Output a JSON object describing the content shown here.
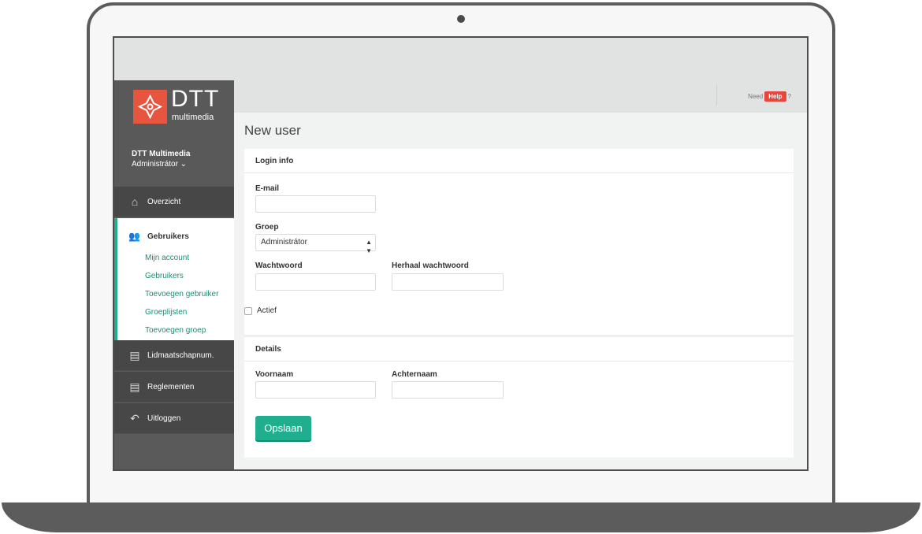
{
  "brand": {
    "logo_main": "DTT",
    "logo_sub": "multimedia",
    "logo_color": "#e8553e"
  },
  "user": {
    "name": "DTT Multimedia",
    "role": "Administrátor ⌄"
  },
  "sidebar": {
    "overzicht": "Overzicht",
    "gebruikers": "Gebruikers",
    "sub_items": [
      "Mijn account",
      "Gebruikers",
      "Toevoegen gebruiker",
      "Groeplijsten",
      "Toevoegen groep"
    ],
    "lidmaatschap": "Lidmaatschapnum.",
    "reglementen": "Reglementen",
    "uitloggen": "Uitloggen",
    "accent_color": "#1fae8e"
  },
  "topbar": {
    "need": "Need",
    "help": "Help",
    "question": "?"
  },
  "page_title": "New user",
  "login_info": {
    "title": "Login info",
    "email_label": "E-mail",
    "email_value": "",
    "groep_label": "Groep",
    "groep_value": "Administrátor",
    "wachtwoord_label": "Wachtwoord",
    "herhaal_label": "Herhaal wachtwoord",
    "actief_label": "Actief"
  },
  "details": {
    "title": "Details",
    "voornaam_label": "Voornaam",
    "achternaam_label": "Achternaam"
  },
  "save_button": "Opslaan"
}
